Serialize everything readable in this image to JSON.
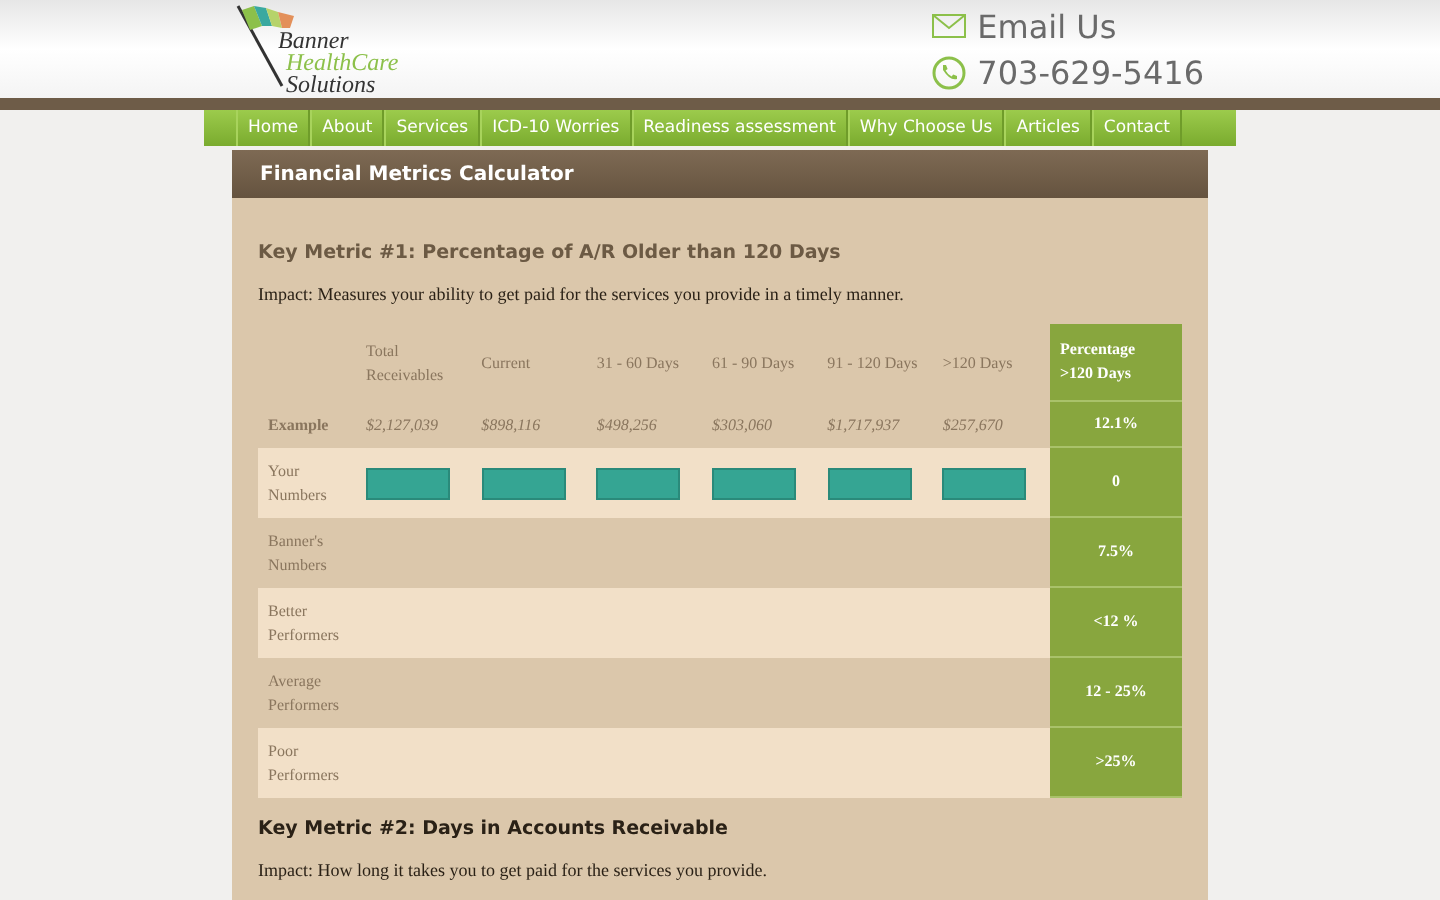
{
  "logo": {
    "line1": "Banner",
    "line2": "HealthCare",
    "line3": "Solutions"
  },
  "contact": {
    "email": "Email Us",
    "phone": "703-629-5416"
  },
  "nav": [
    {
      "label": "Home"
    },
    {
      "label": "About"
    },
    {
      "label": "Services"
    },
    {
      "label": "ICD-10 Worries"
    },
    {
      "label": "Readiness assessment"
    },
    {
      "label": "Why Choose Us"
    },
    {
      "label": "Articles"
    },
    {
      "label": "Contact"
    }
  ],
  "page_title": "Financial Metrics Calculator",
  "metric1": {
    "title": "Key Metric #1: Percentage of A/R Older than 120 Days",
    "impact": "Impact: Measures your ability to get paid for the services you provide in a timely manner.",
    "columns": [
      "Total Receivables",
      "Current",
      "31 - 60 Days",
      "61 - 90 Days",
      "91 - 120 Days",
      ">120 Days"
    ],
    "result_column": "Percentage >120 Days",
    "rows": [
      {
        "kind": "example",
        "label": "Example",
        "cells": [
          "$2,127,039",
          "$898,116",
          "$498,256",
          "$303,060",
          "$1,717,937",
          "$257,670"
        ],
        "result": "12.1%"
      },
      {
        "kind": "input",
        "label": "Your Numbers",
        "result": "0"
      },
      {
        "kind": "plain",
        "label": "Banner's Numbers",
        "result": "7.5%"
      },
      {
        "kind": "plain",
        "label": "Better Performers",
        "result": "<12 %"
      },
      {
        "kind": "plain",
        "label": "Average Performers",
        "result": "12 - 25%"
      },
      {
        "kind": "plain",
        "label": "Poor Performers",
        "result": ">25%"
      }
    ]
  },
  "metric2": {
    "title": "Key Metric #2: Days in Accounts Receivable",
    "impact": "Impact: How long it takes you to get paid for the services you provide."
  }
}
